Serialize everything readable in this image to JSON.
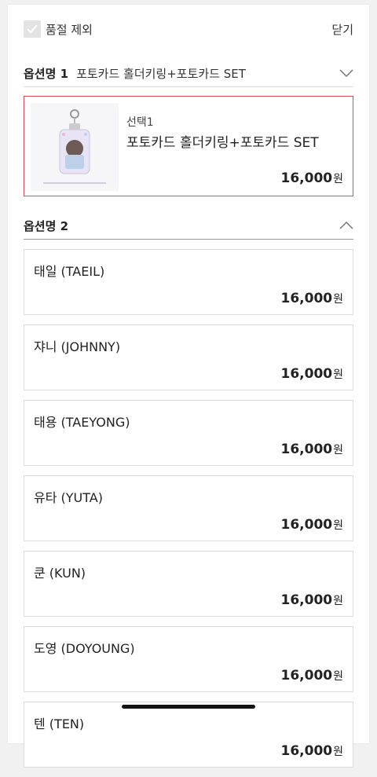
{
  "header": {
    "exclude_soldout_label": "품절 제외",
    "close_label": "닫기"
  },
  "option1": {
    "title": "옵션명 1",
    "value": "포토카드 홀더키링+포토카드 SET"
  },
  "selected_item": {
    "tag": "선택1",
    "name": "포토카드 홀더키링+포토카드 SET",
    "price": "16,000",
    "currency": "원"
  },
  "option2": {
    "title": "옵션명 2",
    "items": [
      {
        "name": "태일 (TAEIL)",
        "price": "16,000",
        "currency": "원"
      },
      {
        "name": "쟈니 (JOHNNY)",
        "price": "16,000",
        "currency": "원"
      },
      {
        "name": "태용 (TAEYONG)",
        "price": "16,000",
        "currency": "원"
      },
      {
        "name": "유타 (YUTA)",
        "price": "16,000",
        "currency": "원"
      },
      {
        "name": "쿤 (KUN)",
        "price": "16,000",
        "currency": "원"
      },
      {
        "name": "도영 (DOYOUNG)",
        "price": "16,000",
        "currency": "원"
      },
      {
        "name": "텐 (TEN)",
        "price": "16,000",
        "currency": "원"
      }
    ]
  },
  "colors": {
    "selected_border": "#d94a56",
    "divider": "#dcdcdc"
  }
}
